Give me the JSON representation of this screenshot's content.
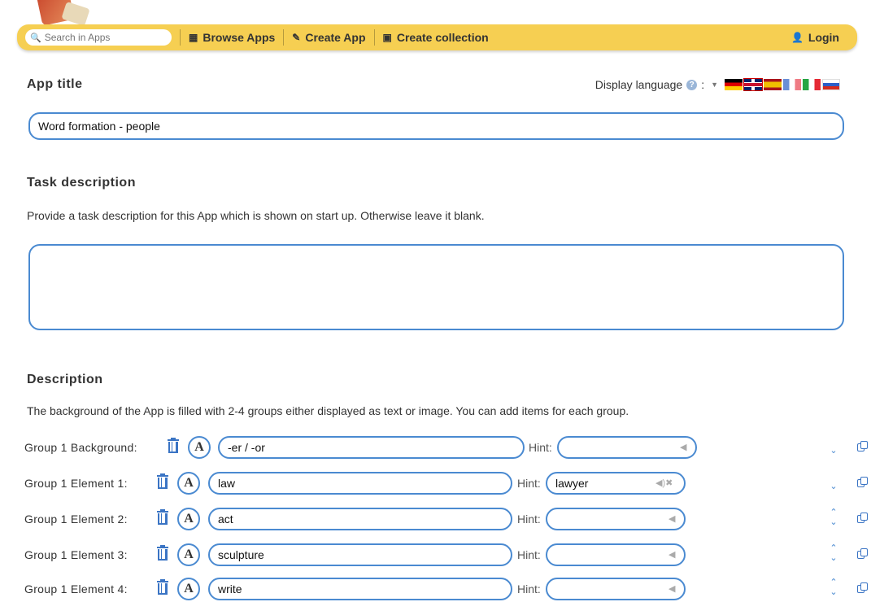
{
  "nav": {
    "search_placeholder": "Search in Apps",
    "browse": "Browse Apps",
    "create_app": "Create App",
    "create_collection": "Create collection",
    "login": "Login"
  },
  "app_title": {
    "label": "App title",
    "value": "Word formation - people"
  },
  "display_language": {
    "label": "Display language",
    "help": "?",
    "colon": ":"
  },
  "task_description": {
    "label": "Task description",
    "text": "Provide a task description for this App which is shown on start up. Otherwise leave it blank.",
    "value": ""
  },
  "description": {
    "label": "Description",
    "text": "The background of the App is filled with 2-4 groups either displayed as text or image. You can add items for each group."
  },
  "hint_label": "Hint:",
  "rows": [
    {
      "label": "Group 1 Background:",
      "value": "-er / -or",
      "hint": ""
    },
    {
      "label": "Group 1 Element 1:",
      "value": "law",
      "hint": "lawyer"
    },
    {
      "label": "Group 1 Element 2:",
      "value": "act",
      "hint": ""
    },
    {
      "label": "Group 1 Element 3:",
      "value": "sculpture",
      "hint": ""
    },
    {
      "label": "Group 1 Element 4:",
      "value": "write",
      "hint": ""
    }
  ],
  "icons": {
    "search": "search-icon",
    "browse": "grid-icon",
    "create": "pencil-icon",
    "collection": "collection-icon",
    "login": "user-icon",
    "trash": "trash-icon",
    "font": "font-A-icon",
    "speaker": "speaker-icon",
    "copy": "copy-icon"
  },
  "colors": {
    "navbar": "#f6cf52",
    "accent": "#4a8ad1"
  }
}
